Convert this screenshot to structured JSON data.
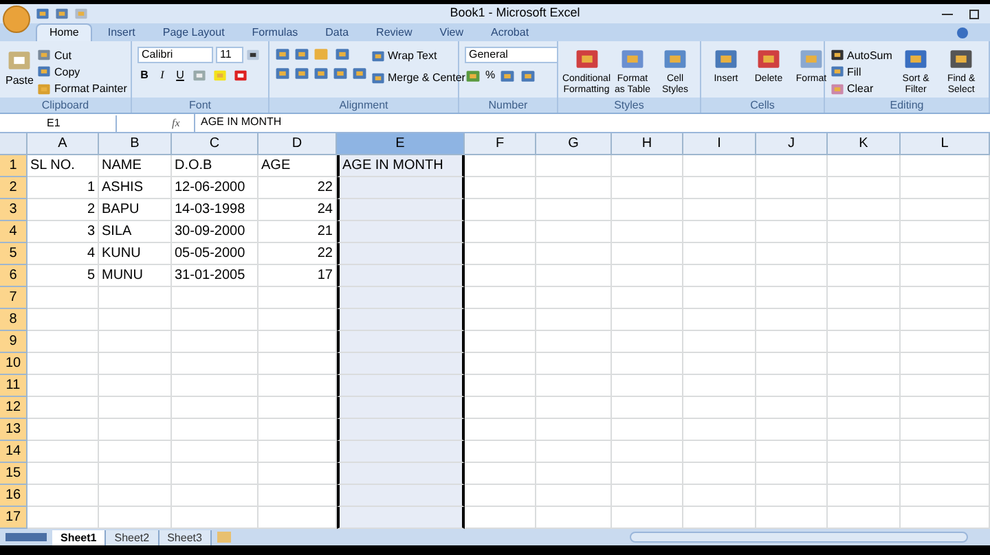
{
  "window": {
    "title": "Book1 - Microsoft Excel"
  },
  "tabs": [
    {
      "label": "Home",
      "selected": true
    },
    {
      "label": "Insert",
      "selected": false
    },
    {
      "label": "Page Layout",
      "selected": false
    },
    {
      "label": "Formulas",
      "selected": false
    },
    {
      "label": "Data",
      "selected": false
    },
    {
      "label": "Review",
      "selected": false
    },
    {
      "label": "View",
      "selected": false
    },
    {
      "label": "Acrobat",
      "selected": false
    }
  ],
  "ribbon": {
    "clipboard": {
      "label": "Clipboard",
      "paste": "Paste",
      "cut": "Cut",
      "copy": "Copy",
      "format_painter": "Format Painter"
    },
    "font": {
      "label": "Font",
      "family": "Calibri",
      "size": "11",
      "bold": "B",
      "italic": "I",
      "underline": "U"
    },
    "alignment": {
      "label": "Alignment",
      "wrap": "Wrap Text",
      "merge": "Merge & Center"
    },
    "number": {
      "label": "Number",
      "format": "General",
      "percent": "%"
    },
    "styles": {
      "label": "Styles",
      "buttons": [
        "Conditional Formatting",
        "Format as Table",
        "Cell Styles"
      ]
    },
    "cells": {
      "label": "Cells",
      "buttons": [
        "Insert",
        "Delete",
        "Format"
      ]
    },
    "editing": {
      "label": "Editing",
      "autosum": "AutoSum",
      "fill": "Fill",
      "clear": "Clear",
      "sort": "Sort & Filter",
      "find": "Find & Select"
    }
  },
  "formula_bar": {
    "name_box": "E1",
    "fx": "fx",
    "value": "AGE IN MONTH"
  },
  "columns": [
    {
      "label": "A",
      "selected": false
    },
    {
      "label": "B",
      "selected": false
    },
    {
      "label": "C",
      "selected": false
    },
    {
      "label": "D",
      "selected": false
    },
    {
      "label": "E",
      "selected": true
    },
    {
      "label": "F",
      "selected": false
    },
    {
      "label": "G",
      "selected": false
    },
    {
      "label": "H",
      "selected": false
    },
    {
      "label": "I",
      "selected": false
    },
    {
      "label": "J",
      "selected": false
    },
    {
      "label": "K",
      "selected": false
    },
    {
      "label": "L",
      "selected": false
    }
  ],
  "rows": [
    {
      "label": "1",
      "selected": true,
      "cells": [
        {
          "text": "SL NO.",
          "kind": "text"
        },
        {
          "text": "NAME",
          "kind": "text"
        },
        {
          "text": "D.O.B",
          "kind": "text"
        },
        {
          "text": "AGE",
          "kind": "text"
        },
        {
          "text": "AGE IN MONTH",
          "kind": "text"
        }
      ]
    },
    {
      "label": "2",
      "selected": true,
      "cells": [
        {
          "text": "1",
          "kind": "number"
        },
        {
          "text": "ASHIS",
          "kind": "text"
        },
        {
          "text": "12-06-2000",
          "kind": "text"
        },
        {
          "text": "22",
          "kind": "number"
        }
      ]
    },
    {
      "label": "3",
      "selected": true,
      "cells": [
        {
          "text": "2",
          "kind": "number"
        },
        {
          "text": "BAPU",
          "kind": "text"
        },
        {
          "text": "14-03-1998",
          "kind": "text"
        },
        {
          "text": "24",
          "kind": "number"
        }
      ]
    },
    {
      "label": "4",
      "selected": true,
      "cells": [
        {
          "text": "3",
          "kind": "number"
        },
        {
          "text": "SILA",
          "kind": "text"
        },
        {
          "text": "30-09-2000",
          "kind": "text"
        },
        {
          "text": "21",
          "kind": "number"
        }
      ]
    },
    {
      "label": "5",
      "selected": true,
      "cells": [
        {
          "text": "4",
          "kind": "number"
        },
        {
          "text": "KUNU",
          "kind": "text"
        },
        {
          "text": "05-05-2000",
          "kind": "text"
        },
        {
          "text": "22",
          "kind": "number"
        }
      ]
    },
    {
      "label": "6",
      "selected": true,
      "cells": [
        {
          "text": "5",
          "kind": "number"
        },
        {
          "text": "MUNU",
          "kind": "text"
        },
        {
          "text": "31-01-2005",
          "kind": "text"
        },
        {
          "text": "17",
          "kind": "number"
        }
      ]
    },
    {
      "label": "7",
      "selected": true,
      "cells": []
    },
    {
      "label": "8",
      "selected": true,
      "cells": []
    },
    {
      "label": "9",
      "selected": true,
      "cells": []
    },
    {
      "label": "10",
      "selected": true,
      "cells": []
    },
    {
      "label": "11",
      "selected": true,
      "cells": []
    },
    {
      "label": "12",
      "selected": true,
      "cells": []
    },
    {
      "label": "13",
      "selected": true,
      "cells": []
    },
    {
      "label": "14",
      "selected": true,
      "cells": []
    },
    {
      "label": "15",
      "selected": true,
      "cells": []
    },
    {
      "label": "16",
      "selected": true,
      "cells": []
    },
    {
      "label": "17",
      "selected": true,
      "cells": []
    }
  ],
  "sheets": [
    {
      "label": "Sheet1",
      "selected": true
    },
    {
      "label": "Sheet2",
      "selected": false
    },
    {
      "label": "Sheet3",
      "selected": false
    }
  ]
}
